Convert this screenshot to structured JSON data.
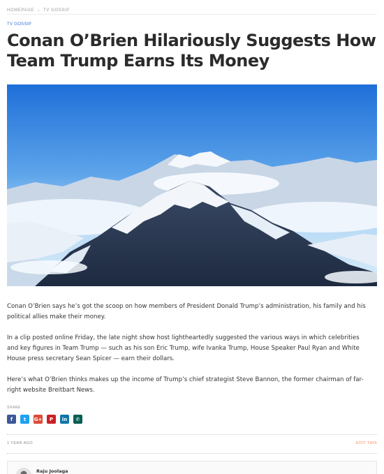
{
  "breadcrumb": {
    "home": "HOMEPAGE",
    "separator": "›",
    "current": "TV GOSSIP"
  },
  "article": {
    "category": "TV GOSSIP",
    "title_lines": [
      "Conan O’Brien Hilariously Suggests How",
      "Team Trump Earns Its Money"
    ],
    "paragraphs": [
      [
        "Conan O’Brien says he’s got the scoop on how members of President Donald Trump’s administration, his family and his",
        "political allies make their money."
      ],
      [
        "In a clip posted online Friday, the late night show host lightheartedly suggested the various ways in which celebrities",
        "and key figures in Team Trump — such as his son Eric Trump, wife Ivanka Trump, House Speaker Paul Ryan and White",
        "House press secretary Sean Spicer — earn their dollars."
      ],
      [
        "Here’s what O’Brien thinks makes up the income of Trump’s chief strategist Steve Bannon, the former chairman of far-",
        "right website Breitbart News."
      ]
    ],
    "hero_image": "snow-capped-mountain-range-above-clouds"
  },
  "share": {
    "label": "SHARE",
    "buttons": [
      {
        "icon": "facebook-icon",
        "glyph": "f",
        "color": "#3b5998"
      },
      {
        "icon": "twitter-icon",
        "glyph": "t",
        "color": "#1da1f2"
      },
      {
        "icon": "google-plus-icon",
        "glyph": "G+",
        "color": "#dd4b39"
      },
      {
        "icon": "pinterest-icon",
        "glyph": "P",
        "color": "#cb2027"
      },
      {
        "icon": "linkedin-icon",
        "glyph": "in",
        "color": "#0e76a8"
      },
      {
        "icon": "whatsapp-icon",
        "glyph": "✆",
        "color": "#075e54"
      }
    ]
  },
  "meta": {
    "time": "1 YEAR AGO",
    "edit": "EDIT THIS"
  },
  "author": {
    "name": "Raju Joolaga"
  }
}
